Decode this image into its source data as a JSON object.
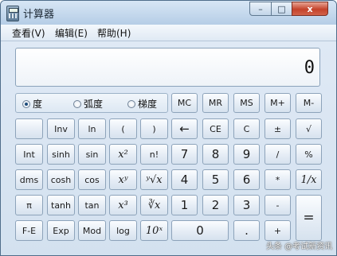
{
  "window": {
    "title": "计算器",
    "minimize_label": "–",
    "maximize_label": "□",
    "close_label": "x"
  },
  "menu": [
    "查看(V)",
    "编辑(E)",
    "帮助(H)"
  ],
  "display": {
    "value": "0"
  },
  "modes": [
    {
      "label": "度",
      "selected": true
    },
    {
      "label": "弧度",
      "selected": false
    },
    {
      "label": "梯度",
      "selected": false
    }
  ],
  "memory_keys": [
    "MC",
    "MR",
    "MS",
    "M+",
    "M-"
  ],
  "keys": {
    "r1": [
      "",
      "Inv",
      "ln",
      "(",
      ")",
      "←",
      "CE",
      "C",
      "±",
      "√"
    ],
    "r2": [
      "Int",
      "sinh",
      "sin",
      "x²",
      "n!",
      "7",
      "8",
      "9",
      "/",
      "%"
    ],
    "r3": [
      "dms",
      "cosh",
      "cos",
      "xʸ",
      "ʸ√x",
      "4",
      "5",
      "6",
      "*",
      "1/x"
    ],
    "r4": [
      "π",
      "tanh",
      "tan",
      "x³",
      "∛x",
      "1",
      "2",
      "3",
      "-",
      "="
    ],
    "r5": [
      "F-E",
      "Exp",
      "Mod",
      "log",
      "10ˣ",
      "0",
      ".",
      "+"
    ]
  },
  "watermark": "头条 @考试新资讯"
}
